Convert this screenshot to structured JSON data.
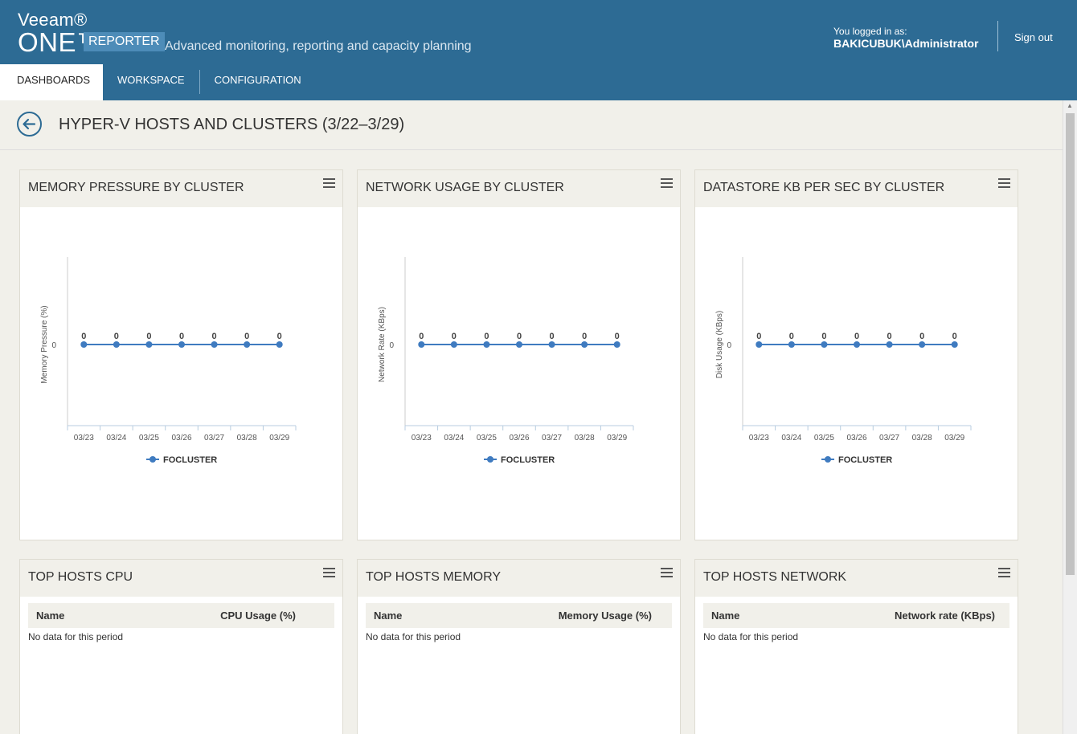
{
  "header": {
    "brand_veeam": "Veeam®",
    "brand_one": "ONE™",
    "brand_product": "REPORTER",
    "tagline": "Advanced monitoring, reporting and capacity planning",
    "login_label": "You logged in as:",
    "login_user": "BAKICUBUK\\Administrator",
    "signout_label": "Sign out"
  },
  "tabs": [
    {
      "label": "DASHBOARDS",
      "active": true
    },
    {
      "label": "WORKSPACE",
      "active": false
    },
    {
      "label": "CONFIGURATION",
      "active": false
    }
  ],
  "page": {
    "title": "HYPER-V HOSTS AND CLUSTERS (3/22–3/29)"
  },
  "widgets": [
    {
      "title": "MEMORY PRESSURE BY CLUSTER"
    },
    {
      "title": "NETWORK USAGE BY CLUSTER"
    },
    {
      "title": "DATASTORE KB PER SEC BY CLUSTER"
    },
    {
      "title": "TOP HOSTS CPU",
      "col1": "Name",
      "col2": "CPU Usage (%)",
      "empty": "No data for this period"
    },
    {
      "title": "TOP HOSTS MEMORY",
      "col1": "Name",
      "col2": "Memory Usage (%)",
      "empty": "No data for this period"
    },
    {
      "title": "TOP HOSTS NETWORK",
      "col1": "Name",
      "col2": "Network rate (KBps)",
      "empty": "No data for this period"
    }
  ],
  "chart_data": [
    {
      "type": "line",
      "title": "MEMORY PRESSURE BY CLUSTER",
      "ylabel": "Memory Pressure (%)",
      "xlabel": "",
      "categories": [
        "03/23",
        "03/24",
        "03/25",
        "03/26",
        "03/27",
        "03/28",
        "03/29"
      ],
      "yticks": [
        0
      ],
      "series": [
        {
          "name": "FOCLUSTER",
          "values": [
            0,
            0,
            0,
            0,
            0,
            0,
            0
          ],
          "color": "#3f7bc0"
        }
      ],
      "legend": "bottom"
    },
    {
      "type": "line",
      "title": "NETWORK USAGE BY CLUSTER",
      "ylabel": "Network Rate (KBps)",
      "xlabel": "",
      "categories": [
        "03/23",
        "03/24",
        "03/25",
        "03/26",
        "03/27",
        "03/28",
        "03/29"
      ],
      "yticks": [
        0
      ],
      "series": [
        {
          "name": "FOCLUSTER",
          "values": [
            0,
            0,
            0,
            0,
            0,
            0,
            0
          ],
          "color": "#3f7bc0"
        }
      ],
      "legend": "bottom"
    },
    {
      "type": "line",
      "title": "DATASTORE KB PER SEC BY CLUSTER",
      "ylabel": "Disk Usage (KBps)",
      "xlabel": "",
      "categories": [
        "03/23",
        "03/24",
        "03/25",
        "03/26",
        "03/27",
        "03/28",
        "03/29"
      ],
      "yticks": [
        0
      ],
      "series": [
        {
          "name": "FOCLUSTER",
          "values": [
            0,
            0,
            0,
            0,
            0,
            0,
            0
          ],
          "color": "#3f7bc0"
        }
      ],
      "legend": "bottom"
    }
  ],
  "colors": {
    "header_bg": "#2d6b94",
    "badge_bg": "#4d8cb8",
    "content_bg": "#f1f0ea",
    "series": "#3f7bc0"
  }
}
